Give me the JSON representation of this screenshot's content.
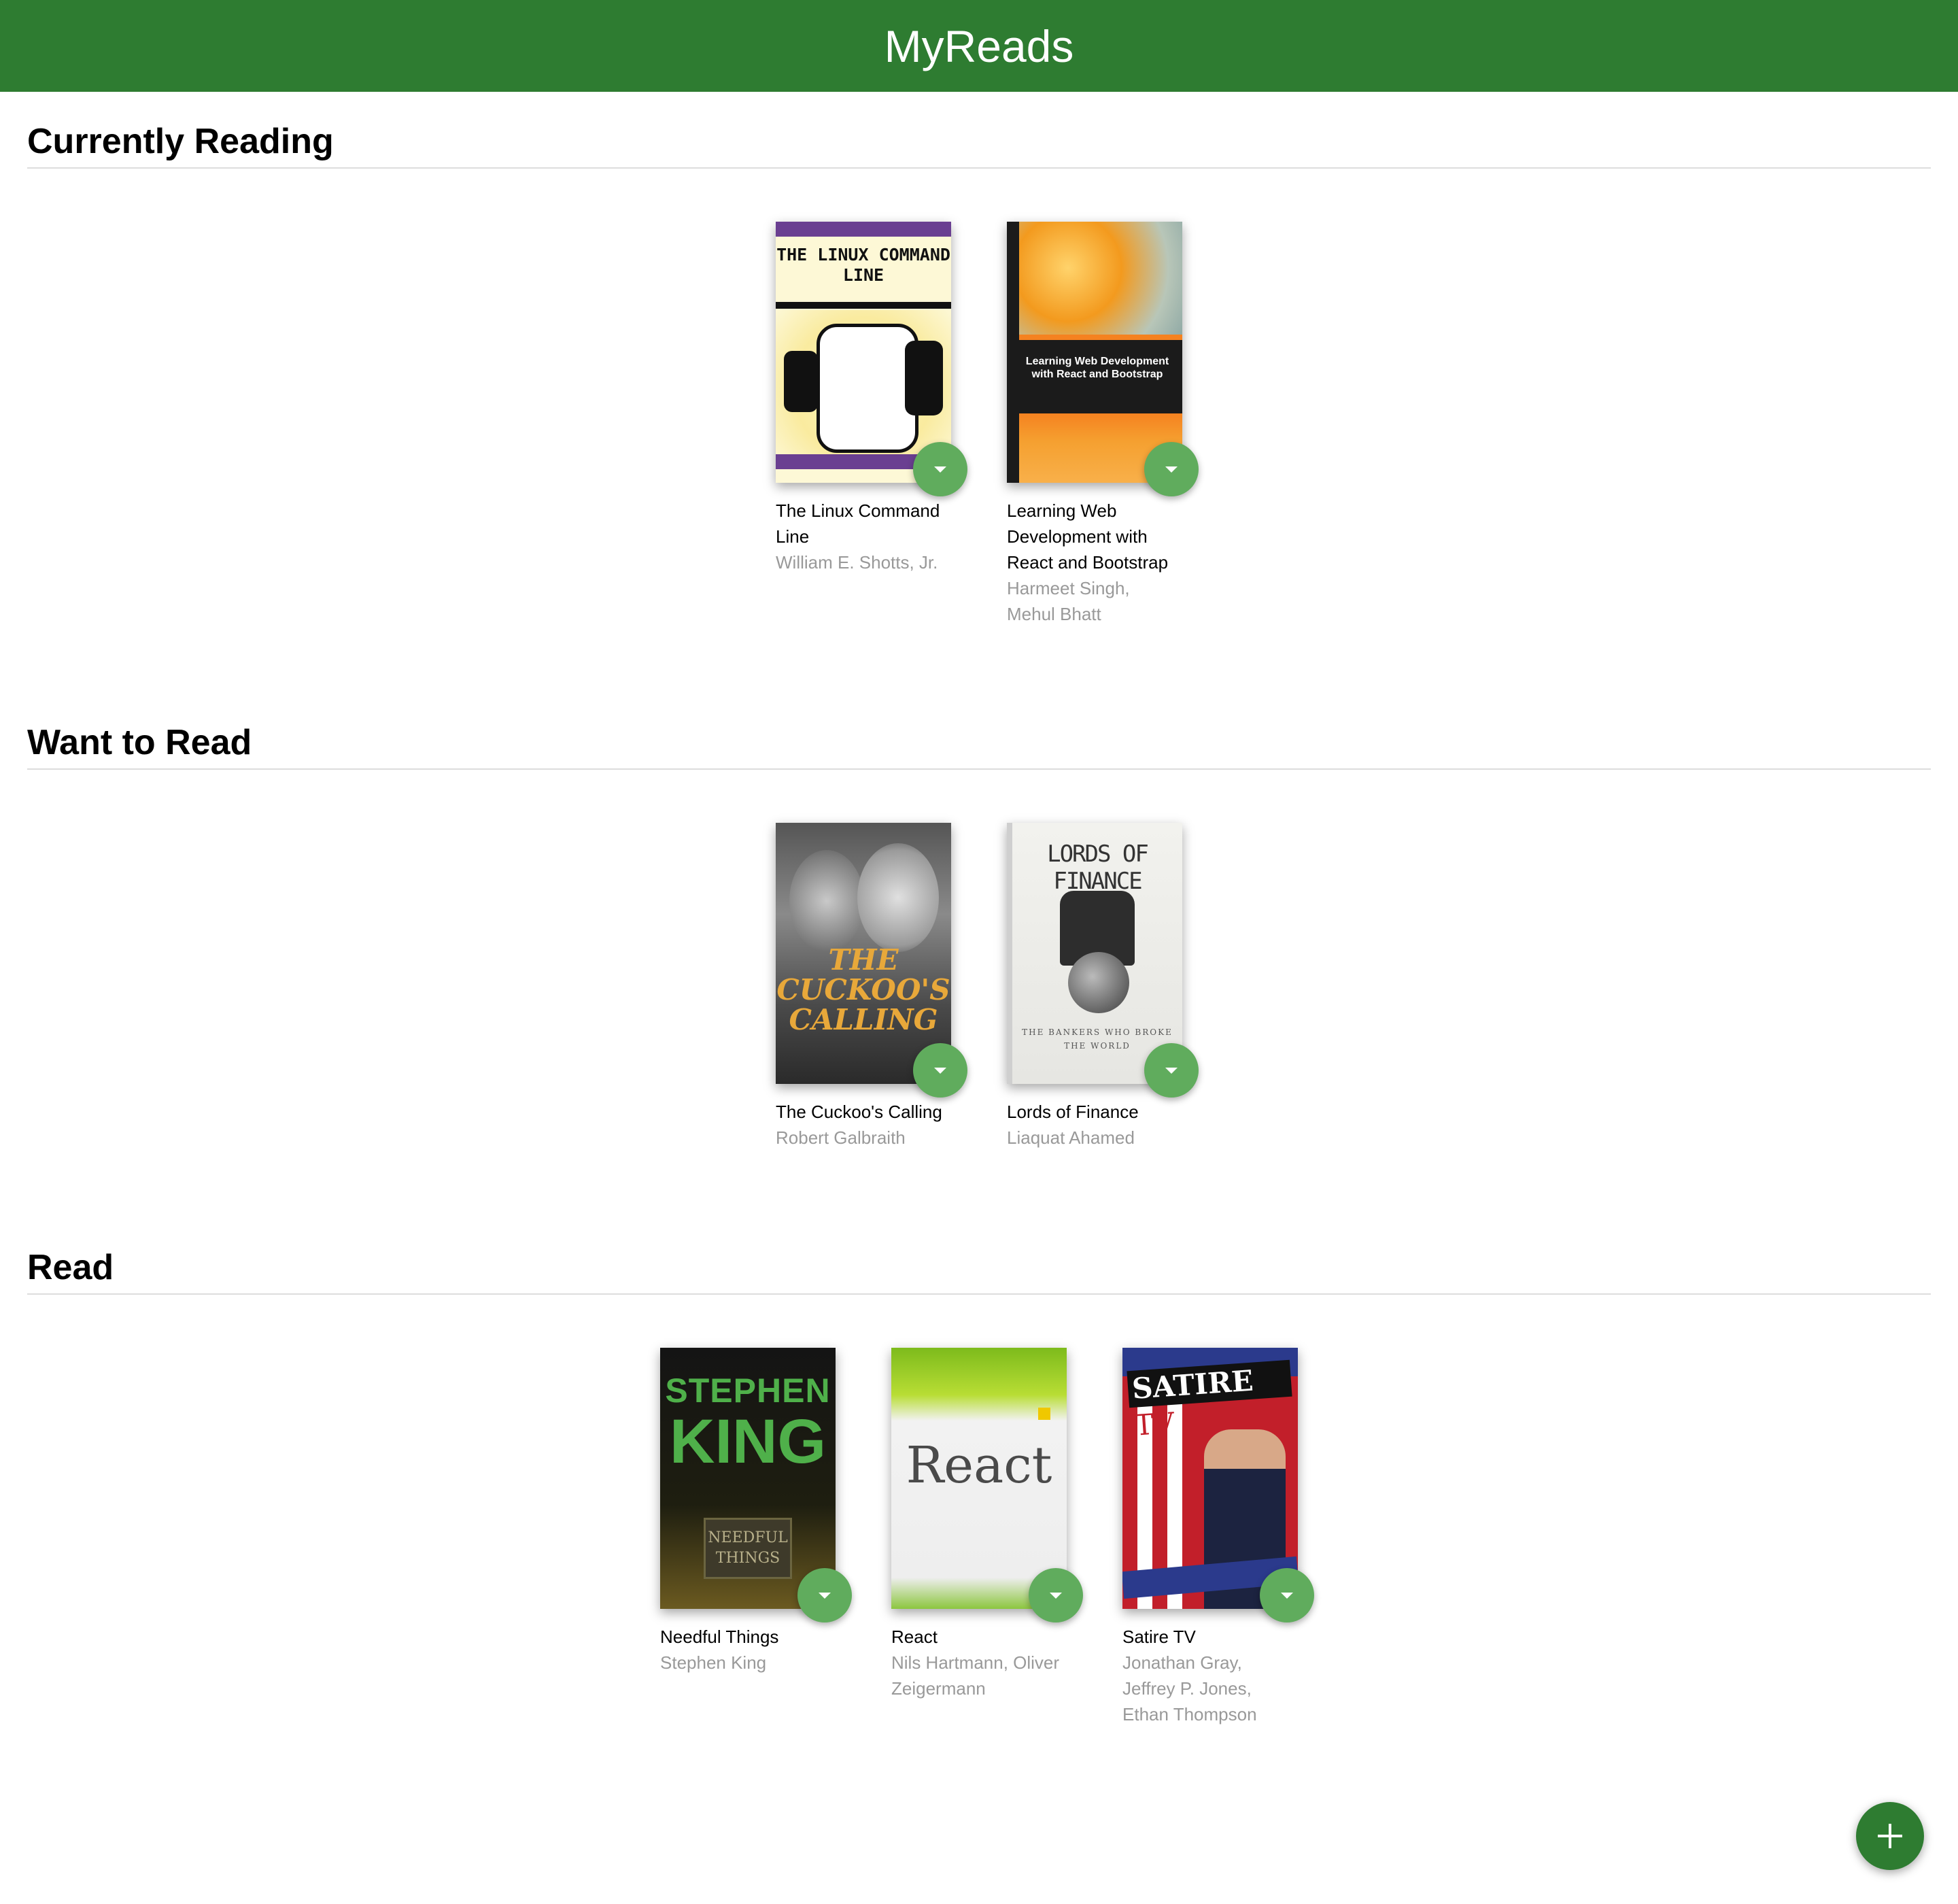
{
  "app": {
    "title": "MyReads"
  },
  "shelves": [
    {
      "title": "Currently Reading",
      "books": [
        {
          "title": "The Linux Command Line",
          "authors": "William E. Shotts, Jr.",
          "cover_text": "THE LINUX COMMAND LINE"
        },
        {
          "title": "Learning Web Development with React and Bootstrap",
          "authors": "Harmeet Singh, Mehul Bhatt",
          "cover_text": "Learning Web Development with React and Bootstrap"
        }
      ]
    },
    {
      "title": "Want to Read",
      "books": [
        {
          "title": "The Cuckoo's Calling",
          "authors": "Robert Galbraith",
          "cover_text": "THE CUCKOO'S CALLING"
        },
        {
          "title": "Lords of Finance",
          "authors": "Liaquat Ahamed",
          "cover_text": "LORDS OF FINANCE",
          "cover_sub": "THE BANKERS WHO BROKE THE WORLD"
        }
      ]
    },
    {
      "title": "Read",
      "books": [
        {
          "title": "Needful Things",
          "authors": "Stephen King",
          "cover_text_1": "STEPHEN",
          "cover_text_2": "KING",
          "cover_sign": "NEEDFUL THINGS"
        },
        {
          "title": "React",
          "authors": "Nils Hartmann, Oliver Zeigermann",
          "cover_text": "React"
        },
        {
          "title": "Satire TV",
          "authors": "Jonathan Gray, Jeffrey P. Jones, Ethan Thompson",
          "cover_text_1": "SATIRE",
          "cover_text_2": "TV"
        }
      ]
    }
  ],
  "icons": {
    "shelf_changer": "caret-down-icon",
    "add": "plus-icon"
  },
  "colors": {
    "app_bar": "#2e7c31",
    "shelf_changer": "#60ac5d",
    "fab": "#2e7c31",
    "author_text": "#999999"
  }
}
